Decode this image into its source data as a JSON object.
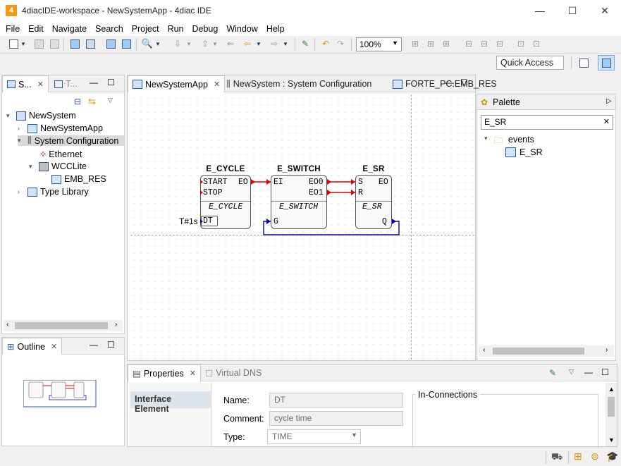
{
  "window": {
    "title": "4diacIDE-workspace - NewSystemApp - 4diac IDE",
    "app_icon_text": "4",
    "minimize": "—",
    "maximize": "☐",
    "close": "✕"
  },
  "menu": [
    "File",
    "Edit",
    "Navigate",
    "Search",
    "Project",
    "Run",
    "Debug",
    "Window",
    "Help"
  ],
  "toolbar": {
    "zoom": "100%",
    "quick_access": "Quick Access"
  },
  "system_tabs": [
    {
      "label": "S..."
    },
    {
      "label": "T..."
    }
  ],
  "tree": {
    "root": "NewSystem",
    "app": "NewSystemApp",
    "sysconf": "System Configuration",
    "ethernet": "Ethernet",
    "device": "WCCLite",
    "resource": "EMB_RES",
    "typelib": "Type Library"
  },
  "outline": {
    "label": "Outline"
  },
  "editor_tabs": [
    {
      "label": "NewSystemApp"
    },
    {
      "label": "NewSystem : System Configuration"
    },
    {
      "label": "FORTE_PC.EMB_RES"
    }
  ],
  "blocks": {
    "cycle": {
      "name": "E_CYCLE",
      "type": "E_CYCLE",
      "in_events": [
        "START",
        "STOP"
      ],
      "out_events": [
        "EO"
      ],
      "in_data": [
        "DT"
      ],
      "param": "T#1s"
    },
    "switch": {
      "name": "E_SWITCH",
      "type": "E_SWITCH",
      "in_events": [
        "EI"
      ],
      "out_events": [
        "EO0",
        "EO1"
      ],
      "in_data": [
        "G"
      ]
    },
    "sr": {
      "name": "E_SR",
      "type": "E_SR",
      "in_events": [
        "S",
        "R"
      ],
      "out_events": [
        "EO"
      ],
      "out_data": [
        "Q"
      ]
    }
  },
  "palette": {
    "title": "Palette",
    "search": "E_SR",
    "folder": "events",
    "item": "E_SR"
  },
  "bottom_tabs": [
    {
      "label": "Properties"
    },
    {
      "label": "Virtual DNS"
    }
  ],
  "properties": {
    "section": "Interface Element",
    "name_label": "Name:",
    "name_value": "DT",
    "comment_label": "Comment:",
    "comment_value": "cycle time",
    "type_label": "Type:",
    "type_value": "TIME",
    "in_connections": "In-Connections"
  },
  "colors": {
    "event_conn": "#e00000",
    "data_conn": "#0000c8",
    "accent": "#2a5aa0"
  }
}
